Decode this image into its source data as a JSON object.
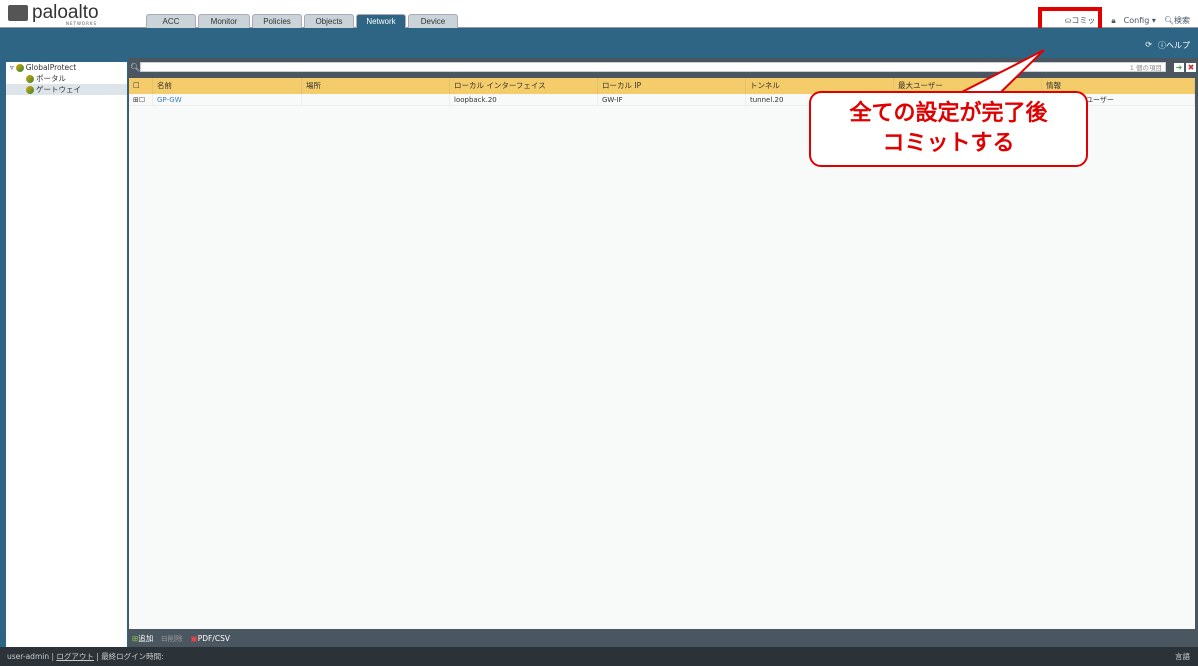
{
  "brand": {
    "name": "paloalto",
    "sub": "NETWORKS"
  },
  "tabs": [
    "ACC",
    "Monitor",
    "Policies",
    "Objects",
    "Network",
    "Device"
  ],
  "top_right": {
    "commit": "コミット",
    "config": "Config",
    "search": "検索"
  },
  "band": {
    "help": "ヘルプ"
  },
  "tree": {
    "root": "GlobalProtect",
    "items": [
      "ポータル",
      "ゲートウェイ"
    ]
  },
  "search": {
    "placeholder": "",
    "count": "1 個の項目"
  },
  "table": {
    "headers": [
      "名前",
      "場所",
      "ローカル インターフェイス",
      "ローカル IP",
      "トンネル",
      "最大ユーザー",
      "情報"
    ],
    "rows": [
      [
        "GP-GW",
        "",
        "loopback.20",
        "GW-IF",
        "tunnel.20",
        "",
        "ユーザー"
      ]
    ]
  },
  "toolbar": {
    "add": "追加",
    "delete": "削除",
    "pdf": "PDF/CSV"
  },
  "status": {
    "user": "user-admin",
    "logout": "ログアウト",
    "last_login": "最終ログイン時間:",
    "lang": "言語"
  },
  "callout": {
    "line1": "全ての設定が完了後",
    "line2": "コミットする"
  }
}
